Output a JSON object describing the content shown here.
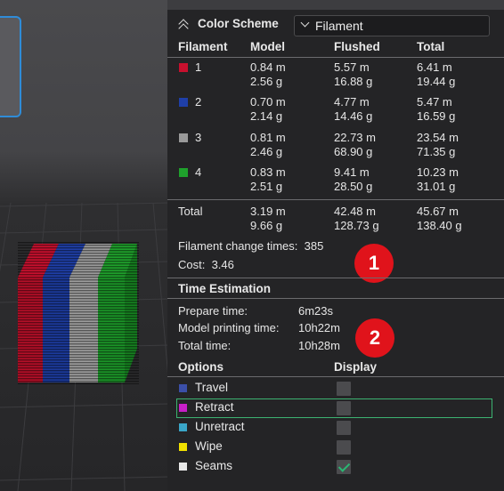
{
  "header": {
    "title": "Color Scheme",
    "selected": "Filament"
  },
  "columns": [
    "Filament",
    "Model",
    "Flushed",
    "Total"
  ],
  "filaments": [
    {
      "id": "1",
      "color": "#c8102e",
      "model_m": "0.84 m",
      "model_g": "2.56 g",
      "flushed_m": "5.57 m",
      "flushed_g": "16.88 g",
      "total_m": "6.41 m",
      "total_g": "19.44 g"
    },
    {
      "id": "2",
      "color": "#1f3fa8",
      "model_m": "0.70 m",
      "model_g": "2.14 g",
      "flushed_m": "4.77 m",
      "flushed_g": "14.46 g",
      "total_m": "5.47 m",
      "total_g": "16.59 g"
    },
    {
      "id": "3",
      "color": "#9a9a9a",
      "model_m": "0.81 m",
      "model_g": "2.46 g",
      "flushed_m": "22.73 m",
      "flushed_g": "68.90 g",
      "total_m": "23.54 m",
      "total_g": "71.35 g"
    },
    {
      "id": "4",
      "color": "#1fa12c",
      "model_m": "0.83 m",
      "model_g": "2.51 g",
      "flushed_m": "9.41 m",
      "flushed_g": "28.50 g",
      "total_m": "10.23 m",
      "total_g": "31.01 g"
    }
  ],
  "totals": {
    "label": "Total",
    "model_m": "3.19 m",
    "model_g": "9.66 g",
    "flushed_m": "42.48 m",
    "flushed_g": "128.73 g",
    "total_m": "45.67 m",
    "total_g": "138.40 g"
  },
  "filament_change": {
    "label": "Filament change times:",
    "value": "385"
  },
  "cost": {
    "label": "Cost:",
    "value": "3.46"
  },
  "badges": [
    "1",
    "2"
  ],
  "time": {
    "title": "Time Estimation",
    "prepare_label": "Prepare time:",
    "prepare_value": "6m23s",
    "model_label": "Model printing time:",
    "model_value": "10h22m",
    "total_label": "Total time:",
    "total_value": "10h28m"
  },
  "options": {
    "title": "Options",
    "display_title": "Display",
    "items": [
      {
        "label": "Travel",
        "color": "#3b4fa8",
        "checked": false
      },
      {
        "label": "Retract",
        "color": "#c81fc8",
        "checked": false
      },
      {
        "label": "Unretract",
        "color": "#3aa6c8",
        "checked": false
      },
      {
        "label": "Wipe",
        "color": "#f0e000",
        "checked": false
      },
      {
        "label": "Seams",
        "color": "#e8e8e8",
        "checked": true
      }
    ]
  }
}
